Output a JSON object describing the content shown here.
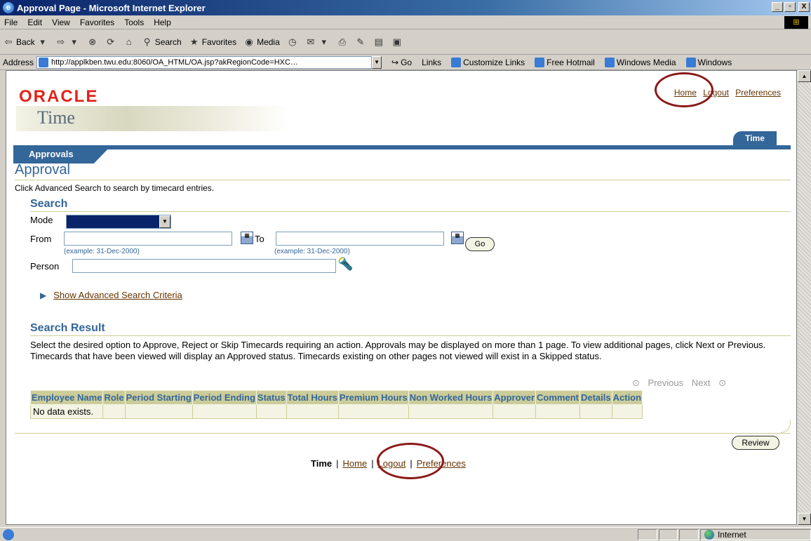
{
  "window": {
    "title": "Approval Page - Microsoft Internet Explorer",
    "icon": "ie-icon",
    "controls": [
      "_",
      "▫",
      "X"
    ]
  },
  "menu": [
    "File",
    "Edit",
    "View",
    "Favorites",
    "Tools",
    "Help"
  ],
  "toolbar": {
    "back": "Back",
    "search": "Search",
    "favorites": "Favorites",
    "media": "Media"
  },
  "addressbar": {
    "label": "Address",
    "url": "http://applkben.twu.edu:8060/OA_HTML/OA.jsp?akRegionCode=HXC…",
    "go": "Go",
    "links_label": "Links",
    "links": [
      "Customize Links",
      "Free Hotmail",
      "Windows Media",
      "Windows"
    ]
  },
  "page": {
    "brand": "ORACLE",
    "product": "Time",
    "global_links": [
      "Home",
      "Logout",
      "Preferences"
    ],
    "tab": "Time",
    "subtab": "Approvals",
    "title": "Approval",
    "instruction": "Click Advanced Search to search by timecard entries.",
    "search": {
      "heading": "Search",
      "mode_label": "Mode",
      "from_label": "From",
      "to_label": "To",
      "from_hint": "(example: 31-Dec-2000)",
      "to_hint": "(example: 31-Dec-2000)",
      "go_label": "Go",
      "person_label": "Person",
      "advanced_link": "Show Advanced Search Criteria"
    },
    "results": {
      "heading": "Search Result",
      "description": "Select the desired option to Approve, Reject or Skip Timecards requiring an action. Approvals may be displayed on more than 1 page. To view additional pages, click Next or Previous. Timecards that have been viewed will display an Approved status. Timecards existing on other pages not viewed will exist in a Skipped status.",
      "previous": "Previous",
      "next": "Next",
      "columns": [
        "Employee Name",
        "Role",
        "Period Starting",
        "Period Ending",
        "Status",
        "Total Hours",
        "Premium Hours",
        "Non Worked Hours",
        "Approver",
        "Comment",
        "Details",
        "Action"
      ],
      "empty_message": "No data exists."
    },
    "review_label": "Review",
    "footer": {
      "current": "Time",
      "links": [
        "Home",
        "Logout",
        "Preferences"
      ],
      "separator": "|"
    }
  },
  "status": {
    "zone": "Internet"
  },
  "colors": {
    "oracle_red": "#e2231a",
    "blue": "#336699",
    "tan": "#cccc99",
    "link": "#663300",
    "highlight_circle": "#8b1a1a"
  }
}
